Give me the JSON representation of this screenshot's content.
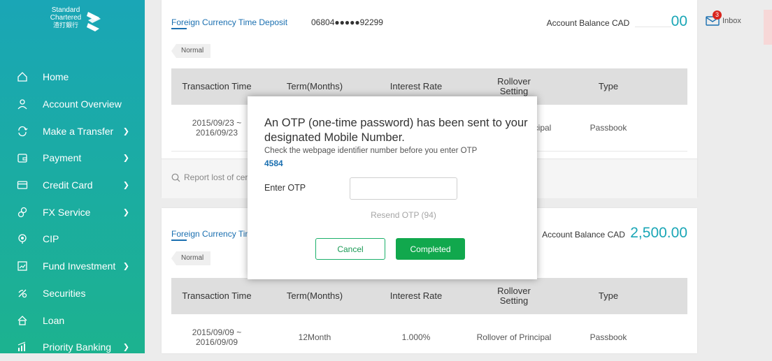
{
  "brand": {
    "name_line1": "Standard",
    "name_line2": "Chartered",
    "name_cn": "渣打銀行",
    "colors": {
      "sidebar_top": "#1aa6b6",
      "sidebar_bottom": "#1cb28f",
      "accent": "#11a84d",
      "link": "#1a6fb0"
    }
  },
  "sidebar": {
    "items": [
      {
        "label": "Home",
        "icon": "home-icon",
        "has_submenu": false
      },
      {
        "label": "Account Overview",
        "icon": "user-icon",
        "has_submenu": false
      },
      {
        "label": "Make a Transfer",
        "icon": "transfer-icon",
        "has_submenu": true
      },
      {
        "label": "Payment",
        "icon": "wallet-icon",
        "has_submenu": true
      },
      {
        "label": "Credit Card",
        "icon": "credit-card-icon",
        "has_submenu": true
      },
      {
        "label": "FX Service",
        "icon": "fx-icon",
        "has_submenu": true
      },
      {
        "label": "CIP",
        "icon": "cip-icon",
        "has_submenu": false
      },
      {
        "label": "Fund Investment",
        "icon": "chart-icon",
        "has_submenu": true
      },
      {
        "label": "Securities",
        "icon": "securities-icon",
        "has_submenu": false
      },
      {
        "label": "Loan",
        "icon": "house-icon",
        "has_submenu": false
      },
      {
        "label": "Priority Banking",
        "icon": "priority-icon",
        "has_submenu": true
      }
    ]
  },
  "header": {
    "inbox_label": "Inbox",
    "inbox_count": "3"
  },
  "accounts": [
    {
      "name": "Foreign Currency Time Deposit",
      "number": "06804●●●●●92299",
      "balance_label": "Account Balance CAD",
      "balance_visible": "00",
      "tag": "Normal",
      "row": {
        "time": "2015/09/23 ~\n2016/09/23",
        "rollover": "Rollover of Principal",
        "type": "Passbook"
      }
    },
    {
      "name": "Foreign Currency Time Deposit",
      "balance_label": "Account Balance CAD",
      "balance": "2,500.00",
      "tag": "Normal",
      "row": {
        "time": "2015/09/09 ~\n2016/09/09",
        "term": "12Month",
        "rate": "1.000%",
        "rollover": "Rollover of Principal",
        "type": "Passbook"
      }
    }
  ],
  "table_headers": {
    "time": "Transaction Time",
    "term": "Term(Months)",
    "rate": "Interest Rate",
    "rollover": "Rollover\nSetting",
    "type": "Type"
  },
  "report_lost": "Report lost of certificate",
  "modal": {
    "title": "An OTP (one-time password) has been sent to your designated Mobile Number.",
    "subtitle": "Check the webpage identifier number before you enter OTP",
    "identifier": "4584",
    "otp_label": "Enter OTP",
    "otp_value": "",
    "resend_label": "Resend OTP (94)",
    "cancel_label": "Cancel",
    "confirm_label": "Completed"
  }
}
